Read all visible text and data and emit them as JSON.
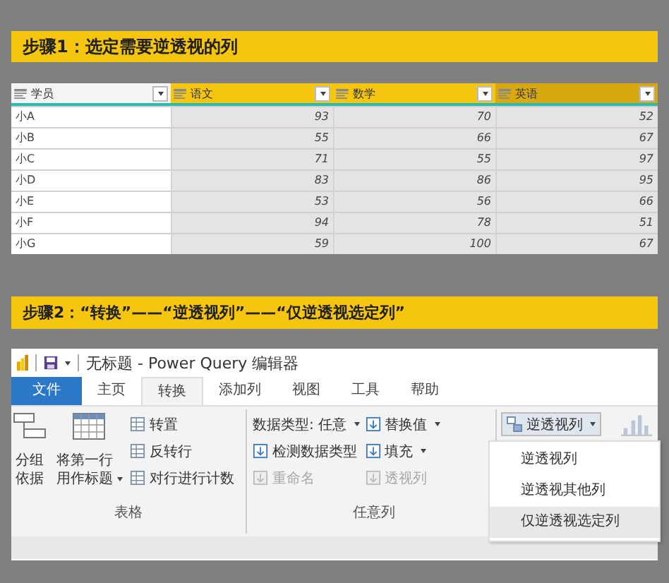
{
  "step1": {
    "title": "步骤1：选定需要逆透视的列"
  },
  "table": {
    "columns": [
      {
        "label": "学员",
        "selected": false,
        "hovered": false
      },
      {
        "label": "语文",
        "selected": true,
        "hovered": false
      },
      {
        "label": "数学",
        "selected": true,
        "hovered": false
      },
      {
        "label": "英语",
        "selected": true,
        "hovered": true
      }
    ],
    "rows": [
      [
        "小A",
        "93",
        "70",
        "52"
      ],
      [
        "小B",
        "55",
        "66",
        "67"
      ],
      [
        "小C",
        "71",
        "55",
        "97"
      ],
      [
        "小D",
        "83",
        "86",
        "95"
      ],
      [
        "小E",
        "53",
        "56",
        "66"
      ],
      [
        "小F",
        "94",
        "78",
        "51"
      ],
      [
        "小G",
        "59",
        "100",
        "67"
      ]
    ]
  },
  "step2": {
    "title": "步骤2：“转换”——“逆透视列”——“仅逆透视选定列”"
  },
  "window": {
    "title": "无标题 - Power Query 编辑器",
    "tabs": [
      {
        "label": "文件",
        "kind": "file",
        "selected": false
      },
      {
        "label": "主页",
        "kind": "tab",
        "selected": false
      },
      {
        "label": "转换",
        "kind": "tab",
        "selected": true
      },
      {
        "label": "添加列",
        "kind": "tab",
        "selected": false
      },
      {
        "label": "视图",
        "kind": "tab",
        "selected": false
      },
      {
        "label": "工具",
        "kind": "tab",
        "selected": false
      },
      {
        "label": "帮助",
        "kind": "tab",
        "selected": false
      }
    ],
    "table_group": {
      "label": "表格",
      "large_buttons": [
        {
          "label": "分组依据",
          "dropdown": false
        },
        {
          "label": "将第一行用作标题",
          "dropdown": true
        }
      ],
      "small_buttons": [
        {
          "label": "转置"
        },
        {
          "label": "反转行"
        },
        {
          "label": "对行进行计数"
        }
      ]
    },
    "any_column_group": {
      "label": "任意列",
      "columns": [
        [
          {
            "label": "数据类型: 任意",
            "kind": "text",
            "dropdown": true,
            "disabled": false
          },
          {
            "label": "检测数据类型",
            "kind": "icon",
            "dropdown": false,
            "disabled": false
          },
          {
            "label": "重命名",
            "kind": "icon",
            "dropdown": false,
            "disabled": true
          }
        ],
        [
          {
            "label": "替换值",
            "kind": "icon",
            "dropdown": true,
            "disabled": false
          },
          {
            "label": "填充",
            "kind": "icon",
            "dropdown": true,
            "disabled": false
          },
          {
            "label": "透视列",
            "kind": "icon",
            "dropdown": false,
            "disabled": true
          }
        ]
      ]
    },
    "unpivot_button": {
      "label": "逆透视列",
      "expanded": true
    },
    "unpivot_menu": [
      {
        "label": "逆透视列",
        "selected": false
      },
      {
        "label": "逆透视其他列",
        "selected": false
      },
      {
        "label": "仅逆透视选定列",
        "selected": true
      }
    ]
  }
}
